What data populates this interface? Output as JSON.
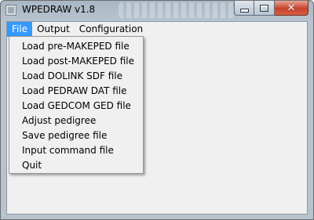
{
  "window": {
    "title": "WPEDRAW v1.8",
    "controls": {
      "minimize": "_",
      "maximize": "□",
      "close": "✕"
    }
  },
  "menubar": {
    "items": [
      {
        "label": "File",
        "active": true
      },
      {
        "label": "Output",
        "active": false
      },
      {
        "label": "Configuration",
        "active": false
      }
    ]
  },
  "file_menu": {
    "items": [
      "Load pre-MAKEPED file",
      "Load post-MAKEPED file",
      "Load DOLINK SDF file",
      "Load PEDRAW DAT file",
      "Load GEDCOM GED file",
      "Adjust pedigree",
      "Save pedigree file",
      "Input command file",
      "Quit"
    ]
  },
  "colors": {
    "menu_highlight": "#3399ff",
    "close_button": "#c7432c"
  }
}
